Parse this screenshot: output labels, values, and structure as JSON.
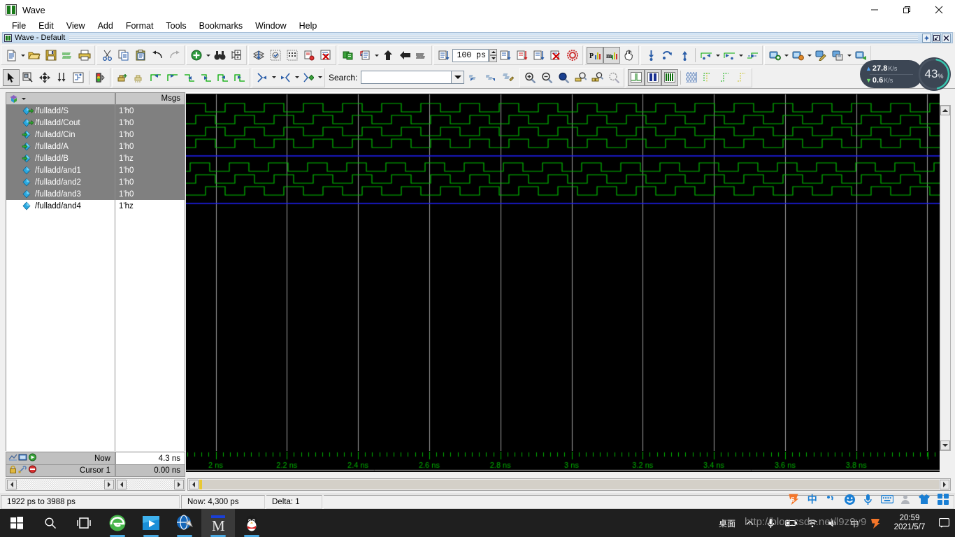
{
  "window": {
    "title": "Wave",
    "icon": "modelsim-wave-icon",
    "minimize": "minimize-button",
    "maximize": "restore-button",
    "close": "close-button"
  },
  "menubar": {
    "items": [
      "File",
      "Edit",
      "View",
      "Add",
      "Format",
      "Tools",
      "Bookmarks",
      "Window",
      "Help"
    ]
  },
  "mdi": {
    "title": "Wave - Default",
    "buttons": [
      "undock",
      "restore",
      "close"
    ]
  },
  "toolbar_row1": {
    "groups": [
      {
        "name": "file-group",
        "buttons": [
          "new-document-icon",
          "dropdown-arrow",
          "open-folder-icon",
          "save-icon",
          "reload-icon",
          "print-icon"
        ]
      },
      {
        "name": "edit-group",
        "buttons": [
          "cut-icon",
          "copy-icon",
          "paste-icon",
          "undo-icon",
          "redo-icon"
        ]
      },
      {
        "name": "add-find-group",
        "buttons": [
          "add-object-icon",
          "dropdown-arrow",
          "find-binoculars-icon",
          "expand-tree-icon"
        ]
      },
      {
        "name": "wave-group",
        "buttons": [
          "collapse-all-icon",
          "dataset-snapshot-icon",
          "grid-icon",
          "signal-search-icon",
          "delete-signal-icon"
        ]
      },
      {
        "name": "sim-group",
        "buttons": [
          "compile-icon",
          "simulate-icon",
          "dropdown-arrow",
          "step-up-icon",
          "step-back-icon",
          "restart-icon"
        ]
      },
      {
        "name": "run-group",
        "buttons": [
          "run-icon"
        ],
        "run_length_value": "100 ps",
        "spinner": "run-length-spinner"
      },
      {
        "name": "run-group2",
        "buttons": [
          "run-all-icon",
          "continue-run-icon",
          "run-next-icon",
          "break-icon",
          "stop-icon"
        ]
      },
      {
        "name": "profile-group",
        "buttons": [
          "profile-performance-icon",
          "profile-memory-icon",
          "pan-hand-icon"
        ]
      },
      {
        "name": "cursor-group",
        "buttons": [
          "insert-cursor-icon",
          "next-transition-icon",
          "previous-cursor-icon",
          "find-falling-edge-icon",
          "dropdown-arrow",
          "find-rising-edge-icon",
          "dropdown-arrow",
          "find-any-edge-icon"
        ]
      },
      {
        "name": "bookmark-group",
        "buttons": [
          "add-bookmark-icon",
          "dropdown-arrow",
          "goto-bookmark-icon",
          "dropdown-arrow",
          "edit-bookmark-icon",
          "save-bookmark-icon",
          "dropdown-arrow",
          "restore-bookmark-icon"
        ]
      }
    ],
    "run_length": "100 ps"
  },
  "toolbar_row2": {
    "groups": [
      {
        "name": "mode-group",
        "buttons": [
          "select-mode-icon",
          "zoom-mode-icon",
          "pan-mode-icon",
          "cursor-mode-icon",
          "edit-mode-icon",
          "traffic-light-icon"
        ]
      },
      {
        "name": "wave-edit-group",
        "buttons": [
          "insert-pulse-icon",
          "delete-edge-icon",
          "invert-left-icon",
          "invert-right-icon",
          "extend-left-icon",
          "extend-right-icon",
          "move-left-icon",
          "move-right-icon"
        ]
      },
      {
        "name": "expand-group",
        "buttons": [
          "expand-time-icon",
          "dropdown-arrow",
          "contract-time-icon",
          "dropdown-arrow",
          "expand-all-time-icon"
        ]
      }
    ],
    "search": {
      "label": "Search:",
      "value": "",
      "placeholder": ""
    },
    "search_buttons": [
      "search-prev-icon",
      "search-next-icon",
      "search-options-icon"
    ],
    "zoom_group": [
      "zoom-in-icon",
      "zoom-out-icon",
      "zoom-full-icon",
      "zoom-cursor-icon",
      "zoom-range-icon",
      "zoom-last-icon"
    ],
    "format_group": [
      "wave-format-literal-icon",
      "wave-format-analog-icon",
      "wave-format-bar-icon",
      "grid-mosaic-icon",
      "grid-rising-icon",
      "grid-falling-icon",
      "grid-both-icon"
    ]
  },
  "netmon": {
    "upload": {
      "value": "27.8",
      "unit": "K/s",
      "arrow": "up-arrow-icon"
    },
    "download": {
      "value": "0.6",
      "unit": "K/s",
      "arrow": "down-arrow-icon"
    },
    "cpu": {
      "value": "43",
      "unit": "%",
      "percent": 43,
      "ring_color": "#4ec3c9"
    }
  },
  "wave": {
    "name_header": {
      "icon": "objects-icon",
      "dropdown": "chevron-down-icon"
    },
    "value_header": "Msgs",
    "signals": [
      {
        "name": "/fulladd/S",
        "value": "1'h0",
        "icon": "signal-out-icon",
        "selected": true,
        "wave": "clock",
        "period": 56,
        "phase": 0,
        "color": "#00c000"
      },
      {
        "name": "/fulladd/Cout",
        "value": "1'h0",
        "icon": "signal-out-icon",
        "selected": true,
        "wave": "clock",
        "period": 56,
        "phase": 14,
        "color": "#00c000"
      },
      {
        "name": "/fulladd/Cin",
        "value": "1'h0",
        "icon": "signal-inout-icon",
        "selected": true,
        "wave": "clock",
        "period": 56,
        "phase": 28,
        "color": "#00c000"
      },
      {
        "name": "/fulladd/A",
        "value": "1'h0",
        "icon": "signal-inout-icon",
        "selected": true,
        "wave": "clock",
        "period": 56,
        "phase": 14,
        "color": "#00c000"
      },
      {
        "name": "/fulladd/B",
        "value": "1'hz",
        "icon": "signal-inout-icon",
        "selected": true,
        "wave": "hiz",
        "period": 0,
        "phase": 0,
        "color": "#2020ff"
      },
      {
        "name": "/fulladd/and1",
        "value": "1'h0",
        "icon": "signal-internal-icon",
        "selected": true,
        "wave": "clock",
        "period": 56,
        "phase": 6,
        "color": "#00c000"
      },
      {
        "name": "/fulladd/and2",
        "value": "1'h0",
        "icon": "signal-internal-icon",
        "selected": true,
        "wave": "clock",
        "period": 56,
        "phase": 14,
        "color": "#00c000"
      },
      {
        "name": "/fulladd/and3",
        "value": "1'h0",
        "icon": "signal-internal-icon",
        "selected": true,
        "wave": "clock",
        "period": 56,
        "phase": 28,
        "color": "#00c000"
      },
      {
        "name": "/fulladd/and4",
        "value": "1'hz",
        "icon": "signal-internal-icon",
        "selected": false,
        "wave": "hiz",
        "period": 0,
        "phase": 0,
        "color": "#2020ff"
      }
    ],
    "background": "#000000",
    "gridline_color": "#a0a0a0",
    "axis": {
      "ticks": [
        "2 ns",
        "2.2 ns",
        "2.4 ns",
        "2.6 ns",
        "2.8 ns",
        "3 ns",
        "3.2 ns",
        "3.4 ns",
        "3.6 ns",
        "3.8 ns"
      ],
      "color": "#00b000",
      "start_ns": 1.922,
      "end_ns": 3.988
    }
  },
  "cursors": {
    "now_label": "Now",
    "now_value": "4.3 ns",
    "cursor_label": "Cursor 1",
    "cursor_value": "0.00 ns",
    "now_icons": [
      "show-drivers-icon",
      "expand-signal-icon",
      "goto-time-icon"
    ],
    "cursor_icons": [
      "lock-cursor-icon",
      "configure-cursor-icon",
      "delete-cursor-icon"
    ]
  },
  "statusbar": {
    "range": "1922 ps to 3988 ps",
    "now": "Now: 4,300 ps",
    "delta": "Delta: 1"
  },
  "tray_strip": {
    "items": [
      "sogou-logo-icon",
      "chinese-mode-icon",
      "punctuation-icon",
      "emoji-icon",
      "microphone-icon",
      "keyboard-icon",
      "user-icon",
      "skin-icon",
      "toolbox-icon"
    ],
    "chinese_label": "中"
  },
  "taskbar": {
    "items": [
      {
        "name": "start-button",
        "icon": "windows-logo-icon"
      },
      {
        "name": "search-button",
        "icon": "search-icon"
      },
      {
        "name": "task-view-button",
        "icon": "task-view-icon"
      },
      {
        "name": "browser-button",
        "icon": "ie-browser-icon",
        "running": true
      },
      {
        "name": "media-player-button",
        "icon": "media-player-icon",
        "running": true
      },
      {
        "name": "network-tool-button",
        "icon": "globe-tool-icon",
        "running": true
      },
      {
        "name": "modelsim-button",
        "icon": "modelsim-icon",
        "running": true,
        "active": true
      },
      {
        "name": "qq-button",
        "icon": "penguin-icon",
        "running": true
      }
    ],
    "desktop_label": "桌面",
    "overflow": "show-hidden-icons-chevron",
    "tray": [
      "microphone-icon",
      "battery-icon",
      "wifi-icon",
      "volume-icon",
      "ime-icon",
      "sogou-icon"
    ],
    "clock": {
      "time": "20:59",
      "date": "2021/5/7"
    },
    "notification": "action-center-icon"
  },
  "watermark": "http://blog.csdn.net/l9z9y9"
}
